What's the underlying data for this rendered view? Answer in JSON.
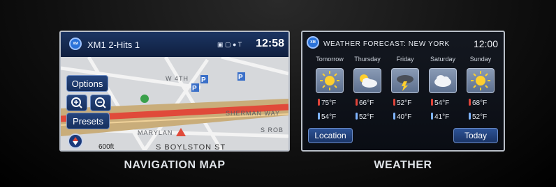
{
  "nav": {
    "logo": "XM",
    "title": "XM1 2-Hits 1",
    "status_icons": "▣ ▢ ● T",
    "clock": "12:58",
    "options_label": "Options",
    "presets_label": "Presets",
    "scale": "600ft",
    "street": "S BOYLSTON ST",
    "map_labels": [
      "W 4TH",
      "SHERMAN WAY",
      "MARYLAN",
      "S ROB"
    ],
    "caption": "NAVIGATION MAP"
  },
  "weather": {
    "logo": "XM",
    "title": "WEATHER FORECAST: NEW YORK",
    "clock": "12:00",
    "days": [
      {
        "name": "Tomorrow",
        "icon": "sun-icon",
        "hi": "75°F",
        "lo": "54°F"
      },
      {
        "name": "Thursday",
        "icon": "partly-cloudy-icon",
        "hi": "66°F",
        "lo": "52°F"
      },
      {
        "name": "Friday",
        "icon": "storm-icon",
        "hi": "52°F",
        "lo": "40°F"
      },
      {
        "name": "Saturday",
        "icon": "cloudy-icon",
        "hi": "54°F",
        "lo": "41°F"
      },
      {
        "name": "Sunday",
        "icon": "sun-icon",
        "hi": "68°F",
        "lo": "52°F"
      }
    ],
    "location_label": "Location",
    "today_label": "Today",
    "caption": "WEATHER"
  },
  "colors": {
    "accent_blue": "#26467e",
    "thermo_hot": "#e0443a",
    "thermo_cold": "#7fb4ff",
    "route_red": "#e04a3a"
  }
}
